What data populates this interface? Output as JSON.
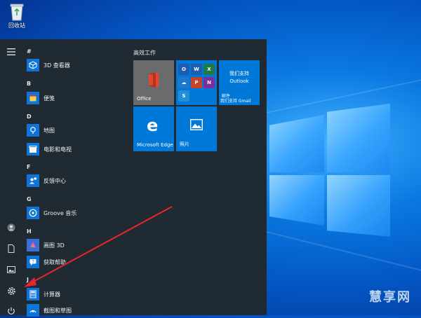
{
  "desktop": {
    "recycle_bin_label": "回收站",
    "watermark": "慧享网"
  },
  "start_menu": {
    "app_list": {
      "letters": [
        "#",
        "B",
        "D",
        "F",
        "G",
        "H",
        "J"
      ],
      "apps": [
        {
          "label": "3D 查看器",
          "icon": "cube-icon"
        },
        {
          "label": "便笺",
          "icon": "sticky-note-icon"
        },
        {
          "label": "地图",
          "icon": "map-icon"
        },
        {
          "label": "电影和电视",
          "icon": "film-icon"
        },
        {
          "label": "反馈中心",
          "icon": "feedback-icon"
        },
        {
          "label": "Groove 音乐",
          "icon": "music-icon"
        },
        {
          "label": "画图 3D",
          "icon": "paint3d-icon"
        },
        {
          "label": "获取帮助",
          "icon": "help-icon"
        },
        {
          "label": "计算器",
          "icon": "calculator-icon"
        },
        {
          "label": "截图和草图",
          "icon": "snip-icon"
        }
      ]
    },
    "tiles": {
      "group_title": "高效工作",
      "office_label": "Office",
      "outlook_label_line1": "我们支持",
      "outlook_label_line2": "Outlook",
      "mail_label": "邮件",
      "mail_support_text": "我们支持 Gmail",
      "edge_label": "Microsoft Edge",
      "photos_label": "照片"
    }
  },
  "colors": {
    "tile_blue": "#0078d7",
    "office_tile": "#6b6b6b",
    "menu_bg": "#1f2a33",
    "arrow_red": "#e8262a"
  }
}
